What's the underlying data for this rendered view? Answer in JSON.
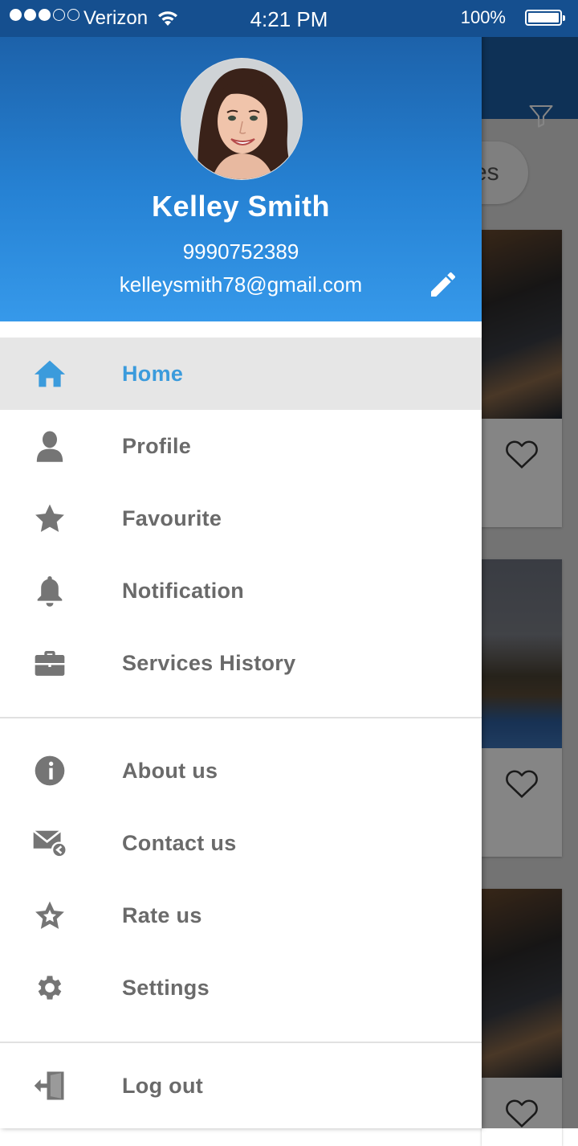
{
  "status_bar": {
    "carrier": "Verizon",
    "time": "4:21 PM",
    "battery": "100%",
    "signal_bars_filled": 3,
    "signal_bars_total": 5
  },
  "profile": {
    "name": "Kelley Smith",
    "phone": "9990752389",
    "email": "kelleysmith78@gmail.com",
    "edit_icon": "pencil-icon"
  },
  "menu": {
    "primary": [
      {
        "label": "Home",
        "icon": "home-icon",
        "active": true
      },
      {
        "label": "Profile",
        "icon": "person-icon",
        "active": false
      },
      {
        "label": "Favourite",
        "icon": "star-icon",
        "active": false
      },
      {
        "label": "Notification",
        "icon": "bell-icon",
        "active": false
      },
      {
        "label": "Services History",
        "icon": "briefcase-icon",
        "active": false
      }
    ],
    "secondary": [
      {
        "label": "About us",
        "icon": "info-icon"
      },
      {
        "label": "Contact us",
        "icon": "mail-reply-icon"
      },
      {
        "label": "Rate us",
        "icon": "star-outline-icon"
      },
      {
        "label": "Settings",
        "icon": "gear-icon"
      }
    ],
    "footer": [
      {
        "label": "Log out",
        "icon": "logout-icon"
      }
    ]
  },
  "background_app": {
    "chip_text": "es",
    "toolbar_icon": "filter-icon"
  },
  "colors": {
    "header_top": "#1a5aa0",
    "header_bottom": "#3699ea",
    "active_label": "#3b9bdc",
    "active_bg": "#e6e6e6",
    "icon_gray": "#757575",
    "label_gray": "#6a6a6a"
  }
}
